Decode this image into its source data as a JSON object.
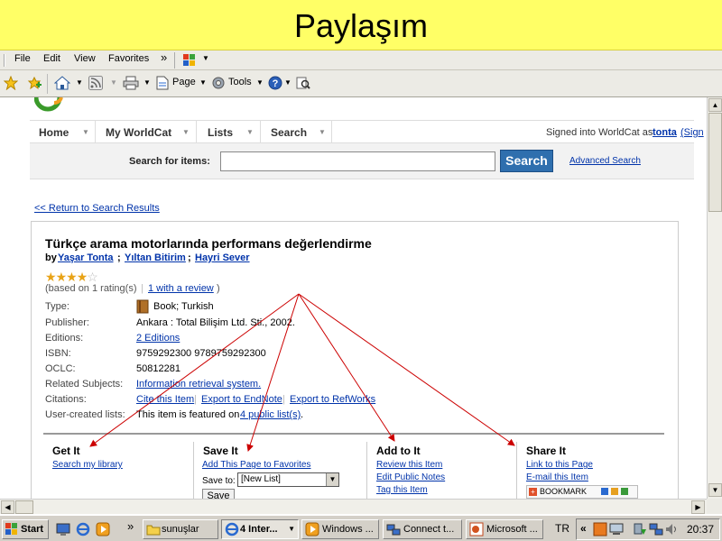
{
  "slide": {
    "title": "Paylaşım"
  },
  "menu": {
    "file": "File",
    "edit": "Edit",
    "view": "View",
    "favorites": "Favorites",
    "more": "»"
  },
  "cmdbar": {
    "page": "Page",
    "tools": "Tools"
  },
  "nav": {
    "tabs": [
      "Home",
      "My WorldCat",
      "Lists",
      "Search"
    ],
    "signed_prefix": "Signed into WorldCat as",
    "username": "tonta",
    "sign_link": "(Sign"
  },
  "search": {
    "label": "Search for items:",
    "button": "Search",
    "advanced": "Advanced Search"
  },
  "return_link": "<< Return to Search Results",
  "item": {
    "title": "Türkçe arama motorlarında performans değerlendirme",
    "by": "by",
    "authors": [
      "Yaşar Tonta",
      "Yıltan Bitirim",
      "Hayri Sever"
    ],
    "rating_text": "(based on 1 rating(s)",
    "review_link": "1 with a review",
    "review_close": ")",
    "rating_value": 4,
    "rating_max": 5
  },
  "fields": {
    "type_label": "Type:",
    "type_value": "Book; Turkish",
    "publisher_label": "Publisher:",
    "publisher_value": "Ankara : Total Bilişim Ltd. Sti., 2002.",
    "editions_label": "Editions:",
    "editions_value": "2 Editions",
    "isbn_label": "ISBN:",
    "isbn_value": "9759292300 9789759292300",
    "oclc_label": "OCLC:",
    "oclc_value": "50812281",
    "subjects_label": "Related Subjects:",
    "subjects_value": "Information retrieval system.",
    "citations_label": "Citations:",
    "cite_link": "Cite this Item",
    "endnote_link": "Export to EndNote",
    "refworks_link": "Export to RefWorks",
    "lists_label": "User-created lists:",
    "lists_text": "This item is featured on",
    "lists_link": "4 public list(s)",
    "lists_end": "."
  },
  "actions": {
    "get_it": {
      "title": "Get It",
      "links": [
        "Search my library"
      ]
    },
    "save_it": {
      "title": "Save It",
      "links": [
        "Add This Page to Favorites"
      ],
      "save_to": "Save to:",
      "select_value": "[New List]",
      "save_btn": "Save"
    },
    "add_to_it": {
      "title": "Add to It",
      "links": [
        "Review this Item",
        "Edit Public Notes",
        "Tag this Item"
      ]
    },
    "share_it": {
      "title": "Share It",
      "links": [
        "Link to this Page",
        "E-mail this Item"
      ],
      "bookmark": "BOOKMARK"
    }
  },
  "taskbar": {
    "start": "Start",
    "more": "»",
    "buttons": [
      "sunuşlar",
      "4 Inter...",
      "Windows ...",
      "Connect t...",
      "Microsoft ..."
    ],
    "lang": "TR",
    "tray_more": "«",
    "clock": "20:37"
  },
  "colors": {
    "slide_bg": "#ffff66",
    "search_btn": "#2f6fae",
    "link": "#0033aa",
    "arrow": "#cc0000"
  }
}
